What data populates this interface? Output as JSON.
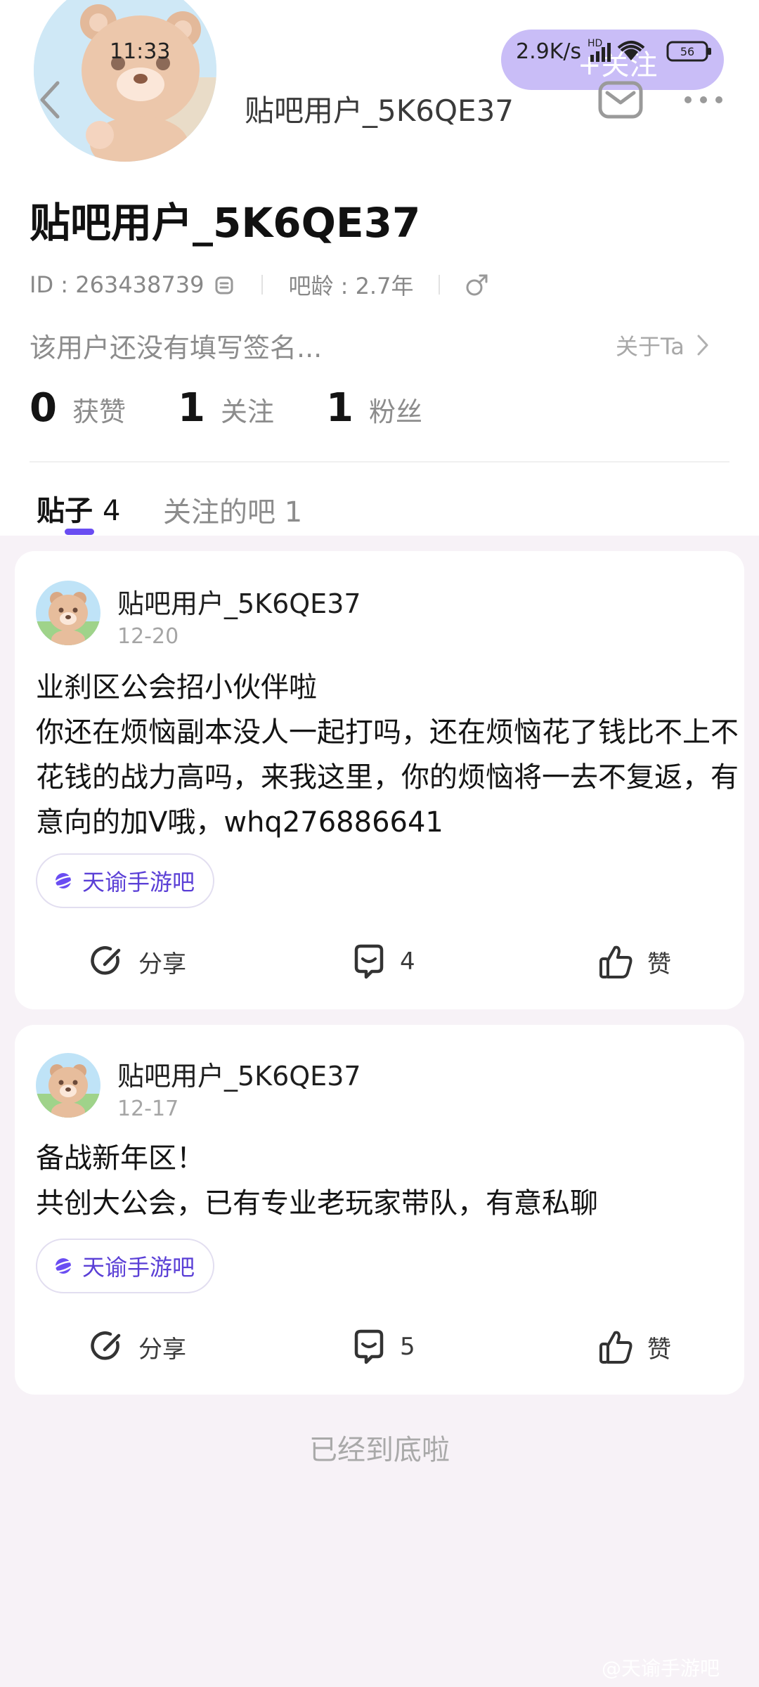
{
  "status_bar": {
    "time": "11:33",
    "network_speed": "2.9K/s",
    "battery": "56"
  },
  "header": {
    "username": "贴吧用户_5K6QE37",
    "follow_button": "+关注"
  },
  "profile": {
    "name": "贴吧用户_5K6QE37",
    "id_text": "ID : 263438739",
    "forum_age": "吧龄 : 2.7年",
    "signature": "该用户还没有填写签名...",
    "about_link": "关于Ta",
    "stats": [
      {
        "value": "0",
        "label": "获赞"
      },
      {
        "value": "1",
        "label": "关注"
      },
      {
        "value": "1",
        "label": "粉丝"
      }
    ]
  },
  "tabs": {
    "posts_label": "贴子",
    "posts_count": "4",
    "follows": "关注的吧 1"
  },
  "posts": [
    {
      "author": "贴吧用户_5K6QE37",
      "date": "12-20",
      "title": "业刹区公会招小伙伴啦",
      "body": "你还在烦恼副本没人一起打吗，还在烦恼花了钱比不上不花钱的战力高吗，来我这里，你的烦恼将一去不复返，有意向的加V哦，whq276886641",
      "forum": "天谕手游吧",
      "share": "分享",
      "comments": "4",
      "like": "赞"
    },
    {
      "author": "贴吧用户_5K6QE37",
      "date": "12-17",
      "title": "备战新年区！",
      "body": "共创大公会，已有专业老玩家带队，有意私聊",
      "forum": "天谕手游吧",
      "share": "分享",
      "comments": "5",
      "like": "赞"
    }
  ],
  "end_text": "已经到底啦",
  "watermark": "@天谕手游吧",
  "colors": {
    "accent": "#6a4df2",
    "follow_pill": "#c9bdf7",
    "page_bg": "#f7f2f7"
  }
}
